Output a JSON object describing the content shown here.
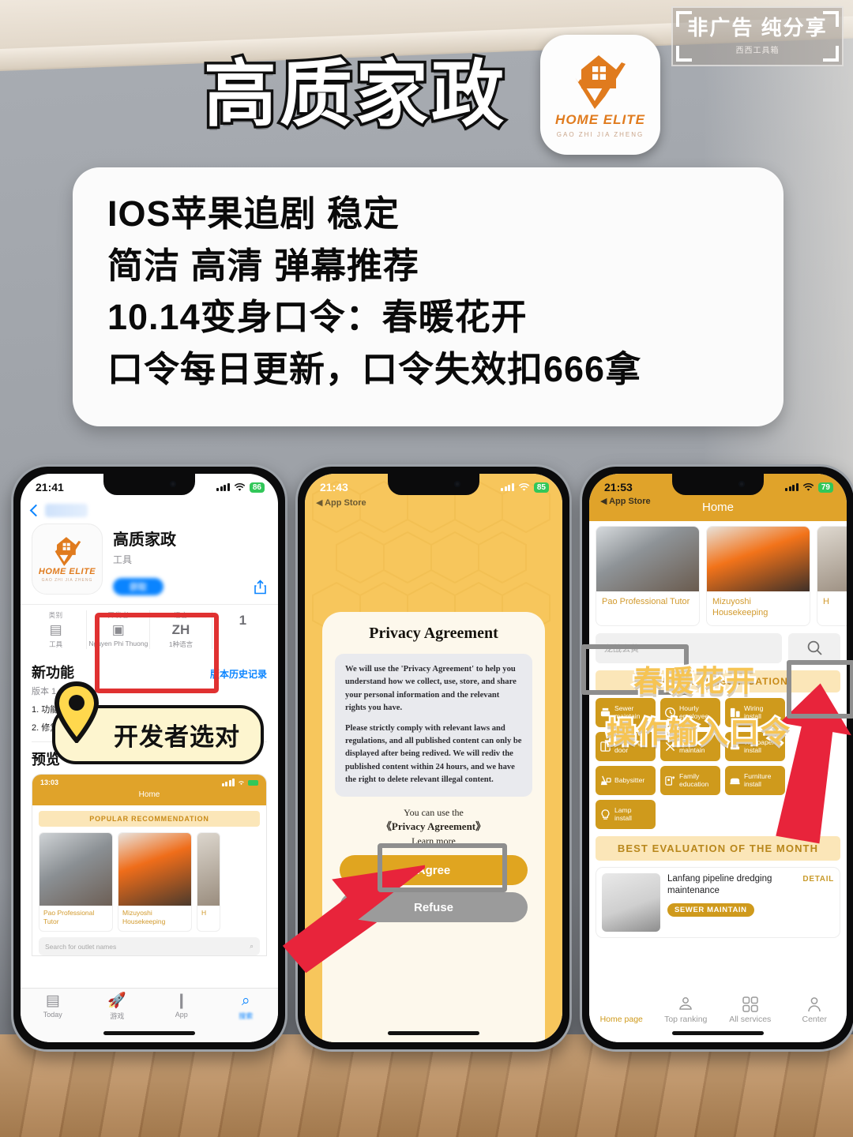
{
  "badge": {
    "main": "非广告 纯分享",
    "sub": "西西工具箱"
  },
  "hero": {
    "title": "高质家政",
    "icon": {
      "name": "HOME ELITE",
      "sub": "GAO ZHI JIA ZHENG"
    }
  },
  "promo": {
    "lines": [
      "IOS苹果追剧 稳定",
      "简洁 高清 弹幕推荐",
      "10.14变身口令：春暖花开",
      "口令每日更新，口令失效扣666拿"
    ]
  },
  "phone1": {
    "status": {
      "time": "21:41",
      "battery": "86"
    },
    "back_label": "",
    "app": {
      "name": "高质家政",
      "category": "工具",
      "get_button": "获取"
    },
    "info": [
      {
        "key": "类别",
        "glyph": "category-icon",
        "value": "工具"
      },
      {
        "key": "开发者",
        "glyph": "person-icon",
        "value": "Nguyen Phi Thuong"
      },
      {
        "key": "语言",
        "big": "ZH",
        "value": "1种语言"
      },
      {
        "key": "年龄",
        "big": "1",
        "value": ""
      }
    ],
    "whatsnew": {
      "title": "新功能",
      "link": "版本历史记录",
      "version": "版本 1",
      "items": [
        "1. 功能",
        "2. 修复"
      ]
    },
    "preview_title": "预览",
    "shot": {
      "time": "13:03",
      "title": "Home",
      "banner": "POPULAR RECOMMENDATION",
      "cards": [
        "Pao Professional Tutor",
        "Mizuyoshi Housekeeping",
        "H"
      ],
      "search_placeholder": "Search for outlet names"
    },
    "tabs": [
      {
        "label": "Today",
        "icon": "today-icon"
      },
      {
        "label": "游戏",
        "icon": "rocket-icon"
      },
      {
        "label": "App",
        "icon": "stack-icon"
      },
      {
        "label": "搜索",
        "icon": "search-icon"
      }
    ],
    "callout": "开发者选对"
  },
  "phone2": {
    "status": {
      "time": "21:43",
      "battery": "85"
    },
    "back_label": "App Store",
    "title": "Privacy Agreement",
    "paragraphs": [
      "We will use the 'Privacy Agreement' to help you understand how we collect, use, store, and share your personal information and the relevant rights you have.",
      "Please strictly comply with relevant laws and regulations, and all published content can only be displayed after being redived. We will rediv the published content within 24 hours, and we have the right to delete relevant illegal content."
    ],
    "foot_line1": "You can use the",
    "foot_line2": "《Privacy Agreement》",
    "foot_line3": "Learn more",
    "agree_button": "Agree",
    "refuse_button": "Refuse"
  },
  "phone3": {
    "status": {
      "time": "21:53",
      "battery": "79"
    },
    "back_label": "App Store",
    "title": "Home",
    "cards": [
      "Pao Professional Tutor",
      "Mizuyoshi Housekeeping",
      "H"
    ],
    "search_placeholder": "龙战玄黄",
    "classification_banner": "SERVICE CLASSIFICATION",
    "services": [
      {
        "label1": "Sewer",
        "label2": "maintain",
        "icon": "sewer-icon"
      },
      {
        "label1": "Hourly",
        "label2": "employee",
        "icon": "clock-icon"
      },
      {
        "label1": "Wiring",
        "label2": "install",
        "icon": "appliance-icon"
      },
      {
        "label1": "Cleaning",
        "label2": "door",
        "icon": "window-icon"
      },
      {
        "label1": "Other",
        "label2": "maintain",
        "icon": "tools-icon"
      },
      {
        "label1": "Wallpaper",
        "label2": "install",
        "icon": "wallpaper-icon"
      },
      {
        "label1": "Babysitter",
        "label2": "",
        "icon": "broom-icon"
      },
      {
        "label1": "Family",
        "label2": "education",
        "icon": "family-icon"
      },
      {
        "label1": "Furniture",
        "label2": "install",
        "icon": "bed-icon"
      },
      {
        "label1": "Lamp",
        "label2": "install",
        "icon": "bulb-icon"
      }
    ],
    "best_banner": "BEST EVALUATION OF THE MONTH",
    "eval": {
      "title": "Lanfang pipeline dredging maintenance",
      "tag": "SEWER MAINTAIN",
      "detail": "DETAIL"
    },
    "tabs": [
      {
        "label": "Home page",
        "icon": "home-icon"
      },
      {
        "label": "Top ranking",
        "icon": "ranking-icon"
      },
      {
        "label": "All services",
        "icon": "grid-icon"
      },
      {
        "label": "Center",
        "icon": "person-icon"
      }
    ],
    "overlay_password": "春暖花开",
    "overlay_instruction": "操作输入口令"
  },
  "colors": {
    "brand_orange": "#e07b1e",
    "app_gold": "#e0a32a",
    "highlight_red": "#e03131",
    "accent_blue": "#0a84ff"
  }
}
